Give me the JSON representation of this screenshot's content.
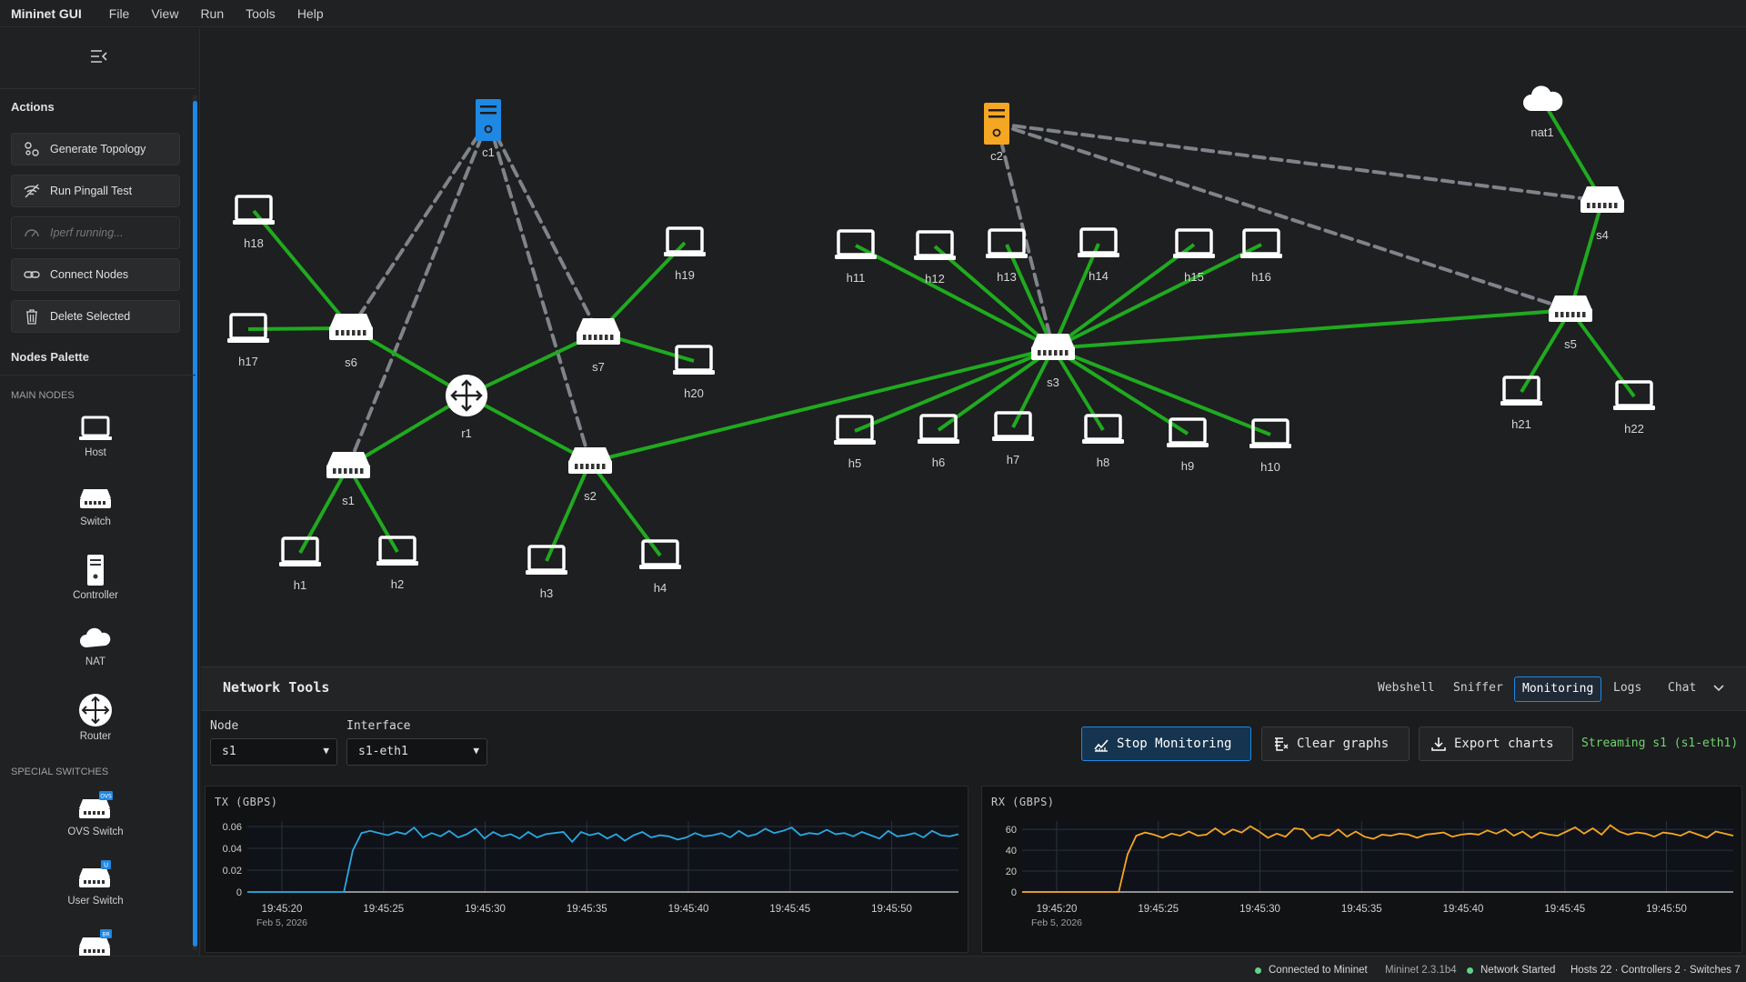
{
  "app": {
    "title": "Mininet GUI",
    "menu": [
      "File",
      "View",
      "Run",
      "Tools",
      "Help"
    ]
  },
  "sidebar": {
    "actions_title": "Actions",
    "actions": [
      {
        "label": "Generate Topology",
        "icon": "topology-icon",
        "enabled": true
      },
      {
        "label": "Run Pingall Test",
        "icon": "ping-icon",
        "enabled": true
      },
      {
        "label": "Iperf running...",
        "icon": "gauge-icon",
        "enabled": false
      },
      {
        "label": "Connect Nodes",
        "icon": "link-icon",
        "enabled": true
      },
      {
        "label": "Delete Selected",
        "icon": "trash-icon",
        "enabled": true
      }
    ],
    "palette_title": "Nodes Palette",
    "main_nodes_label": "MAIN NODES",
    "main_nodes": [
      {
        "label": "Host",
        "icon": "host-icon"
      },
      {
        "label": "Switch",
        "icon": "switch-icon"
      },
      {
        "label": "Controller",
        "icon": "controller-icon"
      },
      {
        "label": "NAT",
        "icon": "cloud-icon"
      },
      {
        "label": "Router",
        "icon": "router-icon"
      }
    ],
    "special_switches_label": "SPECIAL SWITCHES",
    "special_switches": [
      {
        "label": "OVS Switch",
        "icon": "ovs-switch-icon",
        "badge": "OVS"
      },
      {
        "label": "User Switch",
        "icon": "user-switch-icon",
        "badge": "U"
      },
      {
        "label": "",
        "icon": "bridge-switch-icon",
        "badge": "BR"
      }
    ]
  },
  "topology": {
    "colors": {
      "link": "#1faa1f",
      "control_link": "#80838a",
      "c1": "#1e88e5",
      "c2": "#f5a623"
    },
    "nodes": [
      {
        "id": "c1",
        "type": "controller",
        "color": "#1e88e5"
      },
      {
        "id": "c2",
        "type": "controller",
        "color": "#f5a623"
      },
      {
        "id": "nat1",
        "type": "nat"
      },
      {
        "id": "r1",
        "type": "router"
      },
      {
        "id": "s1",
        "type": "switch"
      },
      {
        "id": "s2",
        "type": "switch"
      },
      {
        "id": "s3",
        "type": "switch"
      },
      {
        "id": "s4",
        "type": "switch"
      },
      {
        "id": "s5",
        "type": "switch"
      },
      {
        "id": "s6",
        "type": "switch"
      },
      {
        "id": "s7",
        "type": "switch"
      },
      {
        "id": "h1",
        "type": "host"
      },
      {
        "id": "h2",
        "type": "host"
      },
      {
        "id": "h3",
        "type": "host"
      },
      {
        "id": "h4",
        "type": "host"
      },
      {
        "id": "h5",
        "type": "host"
      },
      {
        "id": "h6",
        "type": "host"
      },
      {
        "id": "h7",
        "type": "host"
      },
      {
        "id": "h8",
        "type": "host"
      },
      {
        "id": "h9",
        "type": "host"
      },
      {
        "id": "h10",
        "type": "host"
      },
      {
        "id": "h11",
        "type": "host"
      },
      {
        "id": "h12",
        "type": "host"
      },
      {
        "id": "h13",
        "type": "host"
      },
      {
        "id": "h14",
        "type": "host"
      },
      {
        "id": "h15",
        "type": "host"
      },
      {
        "id": "h16",
        "type": "host"
      },
      {
        "id": "h17",
        "type": "host"
      },
      {
        "id": "h18",
        "type": "host"
      },
      {
        "id": "h19",
        "type": "host"
      },
      {
        "id": "h20",
        "type": "host"
      },
      {
        "id": "h21",
        "type": "host"
      },
      {
        "id": "h22",
        "type": "host"
      }
    ],
    "links": [
      [
        "h18",
        "s6"
      ],
      [
        "h17",
        "s6"
      ],
      [
        "s6",
        "r1"
      ],
      [
        "r1",
        "s1"
      ],
      [
        "r1",
        "s7"
      ],
      [
        "r1",
        "s2"
      ],
      [
        "s7",
        "h19"
      ],
      [
        "s7",
        "h20"
      ],
      [
        "s1",
        "h1"
      ],
      [
        "s1",
        "h2"
      ],
      [
        "s2",
        "h3"
      ],
      [
        "s2",
        "h4"
      ],
      [
        "s2",
        "s3"
      ],
      [
        "s3",
        "h11"
      ],
      [
        "s3",
        "h12"
      ],
      [
        "s3",
        "h13"
      ],
      [
        "s3",
        "h14"
      ],
      [
        "s3",
        "h15"
      ],
      [
        "s3",
        "h16"
      ],
      [
        "s3",
        "h5"
      ],
      [
        "s3",
        "h6"
      ],
      [
        "s3",
        "h7"
      ],
      [
        "s3",
        "h8"
      ],
      [
        "s3",
        "h9"
      ],
      [
        "s3",
        "h10"
      ],
      [
        "s3",
        "s5"
      ],
      [
        "s5",
        "s4"
      ],
      [
        "s4",
        "nat1"
      ],
      [
        "s5",
        "h21"
      ],
      [
        "s5",
        "h22"
      ]
    ],
    "control_links": [
      [
        "c1",
        "s6"
      ],
      [
        "c1",
        "s1"
      ],
      [
        "c1",
        "s7"
      ],
      [
        "c1",
        "s2"
      ],
      [
        "c2",
        "s3"
      ],
      [
        "c2",
        "s4"
      ],
      [
        "c2",
        "s5"
      ]
    ]
  },
  "tools": {
    "title": "Network Tools",
    "tabs": [
      "Webshell",
      "Sniffer",
      "Monitoring",
      "Logs",
      "Chat"
    ],
    "active_tab": "Monitoring",
    "node_label": "Node",
    "node_value": "s1",
    "interface_label": "Interface",
    "interface_value": "s1-eth1",
    "stop_label": "Stop Monitoring",
    "clear_label": "Clear graphs",
    "export_label": "Export charts",
    "streaming_text": "Streaming s1 (s1-eth1)"
  },
  "chart_data": [
    {
      "type": "line",
      "title": "TX (GBPS)",
      "color": "#29a8e0",
      "x_ticks": [
        "19:45:20",
        "19:45:25",
        "19:45:30",
        "19:45:35",
        "19:45:40",
        "19:45:45",
        "19:45:50"
      ],
      "x_subtitle": "Feb 5, 2026",
      "ylim": [
        0,
        0.065
      ],
      "y_ticks": [
        "0",
        "0.02",
        "0.04",
        "0.06"
      ],
      "grid": true,
      "series": [
        {
          "values": [
            0,
            0,
            0,
            0,
            0,
            0,
            0,
            0,
            0,
            0,
            0,
            0,
            0.038,
            0.054,
            0.056,
            0.054,
            0.052,
            0.055,
            0.053,
            0.059,
            0.05,
            0.054,
            0.051,
            0.056,
            0.05,
            0.053,
            0.058,
            0.049,
            0.055,
            0.051,
            0.053,
            0.049,
            0.055,
            0.05,
            0.053,
            0.054,
            0.055,
            0.046,
            0.055,
            0.052,
            0.054,
            0.049,
            0.053,
            0.047,
            0.052,
            0.055,
            0.05,
            0.052,
            0.051,
            0.048,
            0.05,
            0.054,
            0.051,
            0.052,
            0.054,
            0.05,
            0.056,
            0.051,
            0.053,
            0.058,
            0.054,
            0.056,
            0.059,
            0.052,
            0.054,
            0.053,
            0.057,
            0.053,
            0.054,
            0.051,
            0.055,
            0.052,
            0.049,
            0.056,
            0.051,
            0.052,
            0.054,
            0.05,
            0.056,
            0.052,
            0.051,
            0.053
          ]
        }
      ]
    },
    {
      "type": "line",
      "title": "RX (GBPS)",
      "color": "#f5a623",
      "x_ticks": [
        "19:45:20",
        "19:45:25",
        "19:45:30",
        "19:45:35",
        "19:45:40",
        "19:45:45",
        "19:45:50"
      ],
      "x_subtitle": "Feb 5, 2026",
      "ylim": [
        0,
        68
      ],
      "y_ticks": [
        "0",
        "20",
        "40",
        "60"
      ],
      "grid": true,
      "series": [
        {
          "values": [
            0,
            0,
            0,
            0,
            0,
            0,
            0,
            0,
            0,
            0,
            0,
            0,
            36,
            54,
            57,
            55,
            52,
            56,
            54,
            58,
            54,
            55,
            61,
            55,
            60,
            57,
            63,
            58,
            52,
            56,
            53,
            61,
            60,
            51,
            55,
            54,
            60,
            53,
            58,
            53,
            51,
            55,
            54,
            56,
            55,
            52,
            55,
            56,
            57,
            53,
            55,
            56,
            55,
            59,
            56,
            60,
            54,
            58,
            52,
            57,
            55,
            54,
            58,
            62,
            56,
            61,
            55,
            64,
            58,
            55,
            57,
            56,
            53,
            57,
            56,
            54,
            58,
            55,
            52,
            58,
            56,
            54
          ]
        }
      ]
    }
  ],
  "status": {
    "connected": "Connected to Mininet",
    "version": "Mininet 2.3.1b4",
    "network": "Network Started",
    "counts": "Hosts 22 · Controllers 2 · Switches 7"
  }
}
